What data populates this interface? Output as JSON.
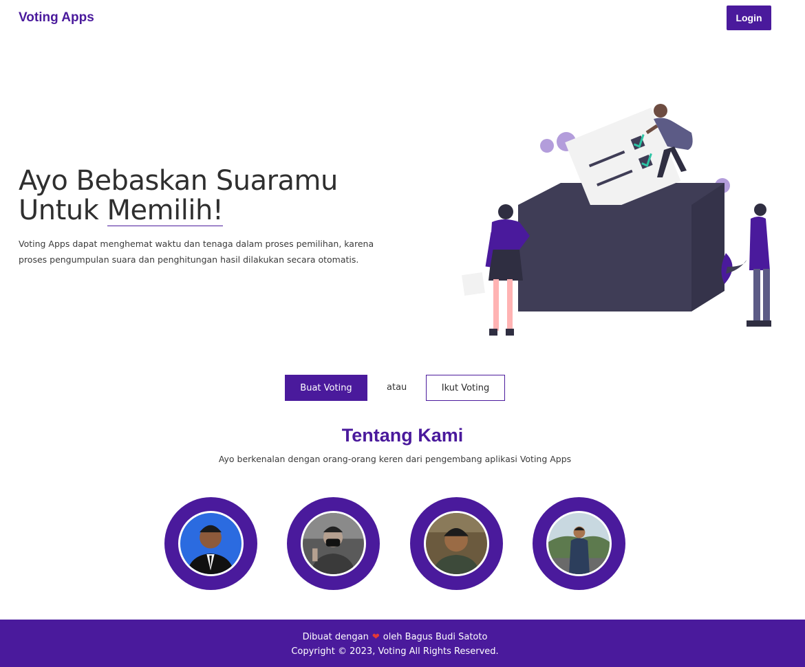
{
  "nav": {
    "brand": "Voting Apps",
    "login_label": "Login"
  },
  "hero": {
    "title_line1": "Ayo Bebaskan Suaramu",
    "title_line2_prefix": "Untuk ",
    "title_line2_highlight": "Memilih!",
    "description": "Voting Apps dapat menghemat waktu dan tenaga dalam proses pemilihan, karena proses pengumpulan suara dan penghitungan hasil dilakukan secara otomatis."
  },
  "cta": {
    "create_label": "Buat Voting",
    "or_label": "atau",
    "join_label": "Ikut Voting"
  },
  "about": {
    "title": "Tentang Kami",
    "subtitle": "Ayo berkenalan dengan orang-orang keren dari pengembang aplikasi Voting Apps"
  },
  "footer": {
    "made_with": "Dibuat dengan",
    "heart": "❤",
    "by": "oleh Bagus Budi Satoto",
    "copyright": "Copyright © 2023, Voting All Rights Reserved."
  },
  "colors": {
    "brand": "#4a1a9c",
    "box": "#3f3d56",
    "check": "#2ec4a5",
    "heart": "#e53935"
  },
  "icons": {
    "heart": "heart-icon",
    "ballot": "ballot-box-illustration"
  }
}
